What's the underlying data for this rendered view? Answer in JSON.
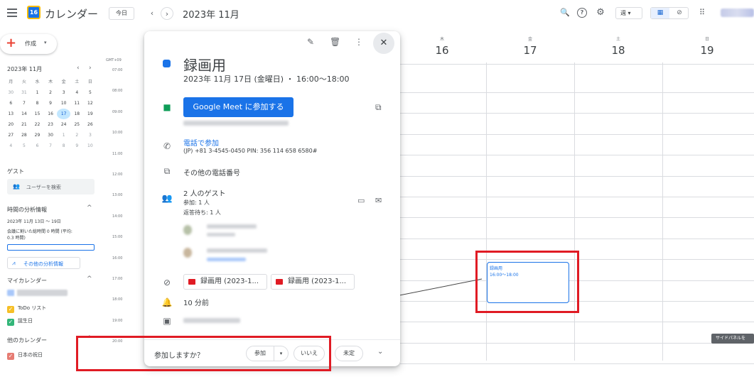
{
  "header": {
    "logo_text": "16",
    "app_title": "カレンダー",
    "today_label": "今日",
    "prev": "‹",
    "next": "›",
    "period": "2023年 11月",
    "search_icon": "🔍",
    "help_icon": "?",
    "settings_icon": "⚙",
    "view_selected": "週 ▾",
    "calendar_icon": "▦",
    "tasks_icon": "⊘",
    "apps_icon": "⠿"
  },
  "sidebar": {
    "create_label": "作成",
    "create_caret": "▾",
    "mini_calendar": {
      "title": "2023年 11月",
      "prev": "‹",
      "next": "›",
      "dows": [
        "月",
        "火",
        "水",
        "木",
        "金",
        "土",
        "日"
      ],
      "weeks": [
        [
          "30",
          "31",
          "1",
          "2",
          "3",
          "4",
          "5"
        ],
        [
          "6",
          "7",
          "8",
          "9",
          "10",
          "11",
          "12"
        ],
        [
          "13",
          "14",
          "15",
          "16",
          "17",
          "18",
          "19"
        ],
        [
          "20",
          "21",
          "22",
          "23",
          "24",
          "25",
          "26"
        ],
        [
          "27",
          "28",
          "29",
          "30",
          "1",
          "2",
          "3"
        ],
        [
          "4",
          "5",
          "6",
          "7",
          "8",
          "9",
          "10"
        ]
      ],
      "selected": "17"
    },
    "guests_heading": "ゲスト",
    "user_search_placeholder": "ユーザーを検索",
    "insights_heading": "時間の分析情報",
    "insights_range": "2023年 11月 13日 ～ 19日",
    "insights_summary_1": "会議に割いた総時間 0 時間 (平均:",
    "insights_summary_2": "0.3 時間)",
    "more_insights_label": "その他の分析情報",
    "my_calendars_heading": "マイカレンダー",
    "my_calendars": [
      {
        "label": "ToDo リスト",
        "color": "#f6bf26"
      },
      {
        "label": "誕生日",
        "color": "#33b679"
      }
    ],
    "other_calendars_heading": "他のカレンダー",
    "other_calendars": [
      {
        "label": "日本の祝日",
        "color": "#e67c73"
      }
    ]
  },
  "grid": {
    "timezone": "GMT+09",
    "times": [
      "07:00",
      "08:00",
      "09:00",
      "10:00",
      "11:00",
      "12:00",
      "13:00",
      "14:00",
      "15:00",
      "16:00",
      "17:00",
      "18:00",
      "19:00",
      "20:00"
    ],
    "days": [
      {
        "dow": "木",
        "num": "16"
      },
      {
        "dow": "金",
        "num": "17"
      },
      {
        "dow": "土",
        "num": "18"
      },
      {
        "dow": "日",
        "num": "19"
      }
    ],
    "event": {
      "title": "録画用",
      "time": "16:00～18:00"
    },
    "side_panel_tooltip": "サイドパネルを"
  },
  "popup": {
    "edit_icon": "✎",
    "delete_icon": "🗑",
    "more_icon": "⋮",
    "close_icon": "✕",
    "title": "録画用",
    "date": "2023年 11月 17日 (金曜日) ・ 16:00～18:00",
    "meet_button": "Google Meet に参加する",
    "copy_icon": "⧉",
    "phone_link": "電話で参加",
    "phone_number": "(JP) +81 3-4545-0450 PIN: 356 114 658 6580#",
    "other_phones": "その他の電話番号",
    "guest_count": "2 人のゲスト",
    "guest_yes": "参加: 1 人",
    "guest_pending": "返答待ち: 1 人",
    "chat_icon": "▭",
    "mail_icon": "✉",
    "attachments": [
      "録画用 (2023-1...",
      "録画用 (2023-1..."
    ],
    "reminder": "10 分前",
    "rsvp_question": "参加しますか？",
    "rsvp_yes": "参加",
    "rsvp_caret": "▾",
    "rsvp_no": "いいえ",
    "rsvp_maybe": "未定",
    "expand_icon": "⌄"
  }
}
